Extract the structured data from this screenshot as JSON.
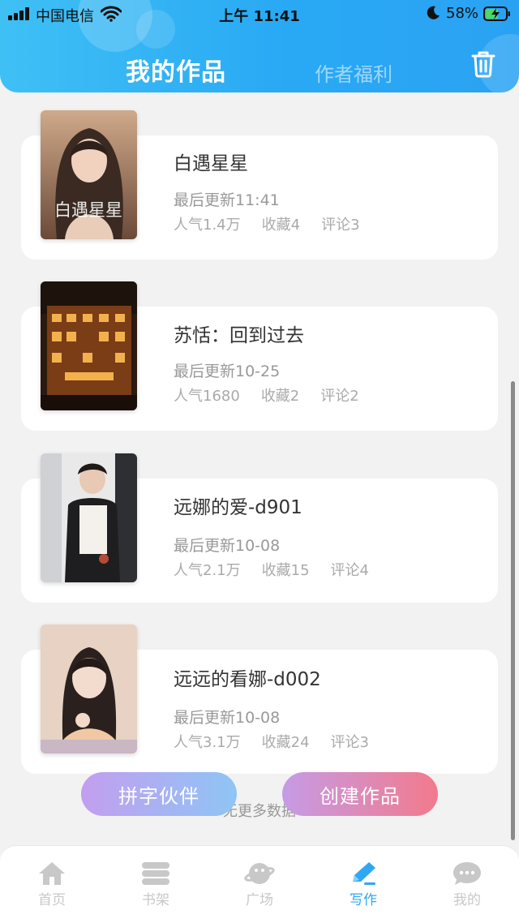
{
  "status_bar": {
    "carrier": "中国电信",
    "time": "上午 11:41",
    "battery": "58%"
  },
  "header": {
    "tabs": [
      "我的作品",
      "作者福利"
    ],
    "active_tab": 0,
    "trash_icon": "trash-icon"
  },
  "books": [
    {
      "title": "白遇星星",
      "updated": "最后更新11:41",
      "popularity": "人气1.4万",
      "favorites": "收藏4",
      "comments": "评论3"
    },
    {
      "title": "苏恬：回到过去",
      "updated": "最后更新10-25",
      "popularity": "人气1680",
      "favorites": "收藏2",
      "comments": "评论2"
    },
    {
      "title": "远娜的爱-d901",
      "updated": "最后更新10-08",
      "popularity": "人气2.1万",
      "favorites": "收藏15",
      "comments": "评论4"
    },
    {
      "title": "远远的看娜-d002",
      "updated": "最后更新10-08",
      "popularity": "人气3.1万",
      "favorites": "收藏24",
      "comments": "评论3"
    }
  ],
  "cover_text": {
    "book0": "白遇星星"
  },
  "list_footer": "无更多数据",
  "actions": {
    "partner": "拼字伙伴",
    "create": "创建作品"
  },
  "tabbar": [
    {
      "label": "首页",
      "icon": "home-icon"
    },
    {
      "label": "书架",
      "icon": "bookshelf-icon"
    },
    {
      "label": "广场",
      "icon": "planet-icon"
    },
    {
      "label": "写作",
      "icon": "pen-icon"
    },
    {
      "label": "我的",
      "icon": "chat-icon"
    }
  ],
  "active_tab_index": 3,
  "colors": {
    "header_start": "#3fc0f5",
    "header_end": "#2aa2f3",
    "active_tab": "#2fa7f3",
    "inactive_tab": "#c8c8c8",
    "partner_gradient": [
      "#c39ef0",
      "#8ec5f5"
    ],
    "create_gradient": [
      "#c69be6",
      "#f27a8c"
    ]
  }
}
